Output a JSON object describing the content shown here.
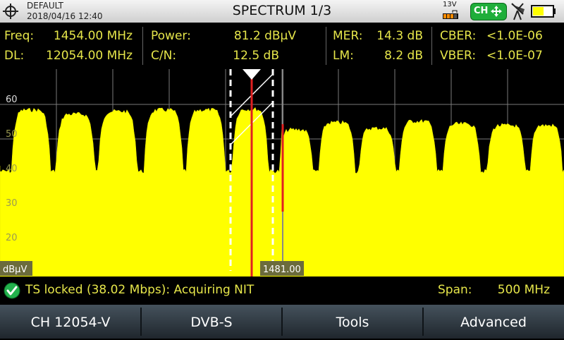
{
  "header": {
    "profile": "DEFAULT",
    "datetime": "2018/04/16 12:40",
    "title": "SPECTRUM 1/3",
    "voltage": "13V",
    "ch_button": "CH",
    "colors": {
      "ch_button": "#1fae3a",
      "battery": "#ffff00"
    }
  },
  "measurements": {
    "freq": {
      "label": "Freq:",
      "value": "1454.00 MHz"
    },
    "dl": {
      "label": "DL:",
      "value": "12054.00 MHz"
    },
    "power": {
      "label": "Power:",
      "value": "81.2 dBµV"
    },
    "cn": {
      "label": "C/N:",
      "value": "12.5 dB"
    },
    "mer": {
      "label": "MER:",
      "value": "14.3 dB"
    },
    "lm": {
      "label": "LM:",
      "value": "8.2 dB"
    },
    "cber": {
      "label": "CBER:",
      "value": "<1.0E-06"
    },
    "vber": {
      "label": "VBER:",
      "value": "<1.0E-07"
    }
  },
  "spectrum": {
    "y_ticks": [
      "60",
      "50",
      "40",
      "30",
      "20"
    ],
    "unit": "dBµV",
    "marker_label": "1481.00",
    "colors": {
      "trace": "#ffff00",
      "marker": "#e02020",
      "grid": "#7a7a7a"
    }
  },
  "status": {
    "text": "TS locked (38.02 Mbps): Acquiring NIT",
    "span_label": "Span:",
    "span_value": "500 MHz"
  },
  "softkeys": [
    "CH 12054-V",
    "DVB-S",
    "Tools",
    "Advanced"
  ]
}
